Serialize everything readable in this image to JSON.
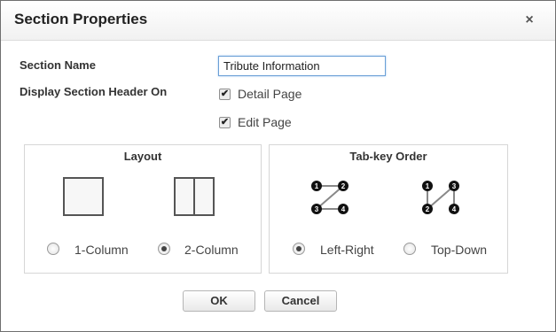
{
  "dialog": {
    "title": "Section Properties",
    "close_glyph": "×"
  },
  "form": {
    "section_name_label": "Section Name",
    "section_name_value": "Tribute Information",
    "display_header_label": "Display Section Header On",
    "detail_page": {
      "label": "Detail Page",
      "checked": true
    },
    "edit_page": {
      "label": "Edit Page",
      "checked": true
    },
    "check_glyph": "✔"
  },
  "layout": {
    "title": "Layout",
    "options": [
      {
        "label": "1-Column",
        "selected": false,
        "icon": "one-column-icon"
      },
      {
        "label": "2-Column",
        "selected": true,
        "icon": "two-column-icon"
      }
    ]
  },
  "tab_order": {
    "title": "Tab-key Order",
    "options": [
      {
        "label": "Left-Right",
        "selected": true,
        "icon": "left-right-order-icon",
        "nodes": [
          "1",
          "2",
          "3",
          "4"
        ]
      },
      {
        "label": "Top-Down",
        "selected": false,
        "icon": "top-down-order-icon",
        "nodes": [
          "1",
          "3",
          "2",
          "4"
        ]
      }
    ]
  },
  "buttons": {
    "ok": "OK",
    "cancel": "Cancel"
  }
}
